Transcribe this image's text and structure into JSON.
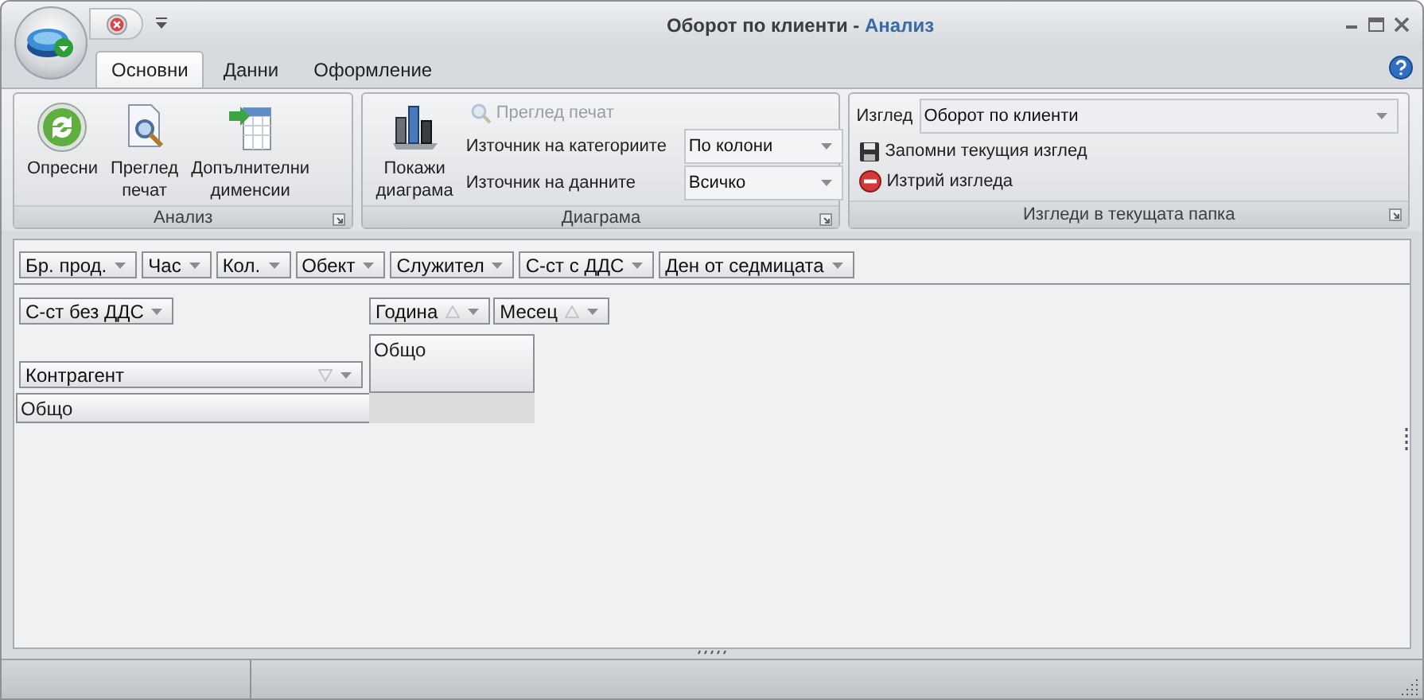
{
  "window": {
    "document_title": "Оборот по клиенти -",
    "app_name": "Анализ"
  },
  "tabs": [
    {
      "label": "Основни",
      "selected": true
    },
    {
      "label": "Данни",
      "selected": false
    },
    {
      "label": "Оформление",
      "selected": false
    }
  ],
  "ribbon": {
    "analysis": {
      "title": "Анализ",
      "buttons": [
        {
          "kind": "refresh",
          "label": "Опресни"
        },
        {
          "kind": "preview",
          "label": "Преглед печат"
        },
        {
          "kind": "dimensions",
          "label": "Допълнителни дименсии"
        }
      ]
    },
    "diagram": {
      "title": "Диаграма",
      "show_button": {
        "label": "Покажи диаграма"
      },
      "preview_button": {
        "label": "Преглед печат",
        "disabled": true
      },
      "fields": [
        {
          "label": "Източник на категориите",
          "value": "По колони"
        },
        {
          "label": "Източник на данните",
          "value": "Всичко"
        }
      ]
    },
    "views": {
      "title": "Изгледи в текущата папка",
      "view_field": {
        "label": "Изглед",
        "value": "Оборот по клиенти"
      },
      "buttons": [
        {
          "kind": "save",
          "label": "Запомни текущия изглед"
        },
        {
          "kind": "delete",
          "label": "Изтрий изгледа"
        }
      ]
    }
  },
  "pivot": {
    "filter_fields": [
      {
        "label": "Бр. прод."
      },
      {
        "label": "Час"
      },
      {
        "label": "Кол."
      },
      {
        "label": "Обект"
      },
      {
        "label": "Служител"
      },
      {
        "label": "С-ст с ДДС"
      },
      {
        "label": "Ден от седмицата"
      }
    ],
    "data_fields": [
      {
        "label": "С-ст без ДДС"
      }
    ],
    "column_fields": [
      {
        "label": "Година",
        "sort_descending": false
      },
      {
        "label": "Месец",
        "sort_descending": false
      }
    ],
    "row_fields": [
      {
        "label": "Контрагент",
        "sort_descending": true
      }
    ],
    "column_total": "Общо",
    "row_total": "Общо"
  }
}
